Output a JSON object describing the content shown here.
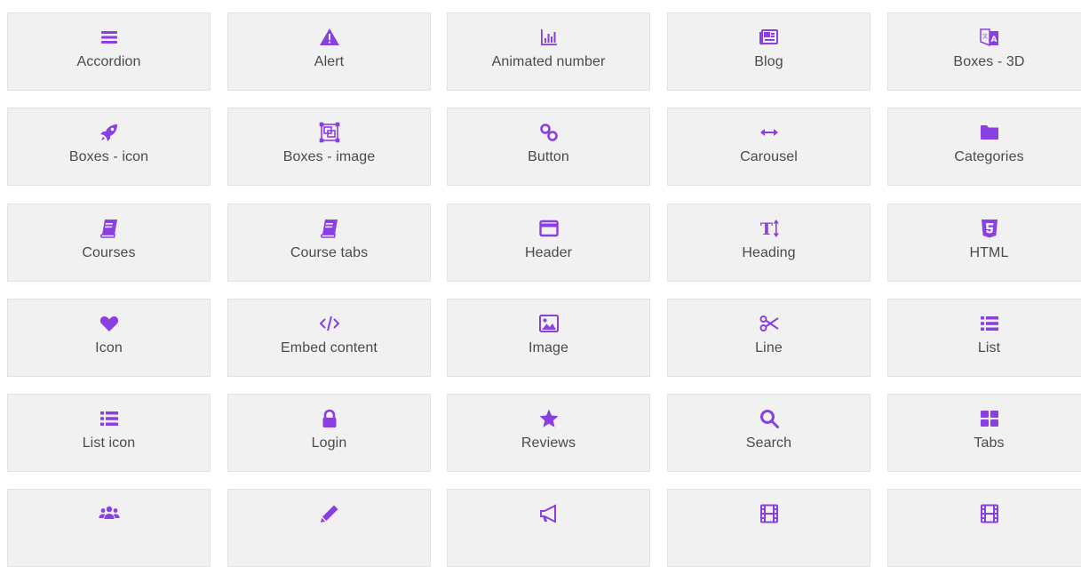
{
  "tiles": [
    {
      "label": "Accordion",
      "icon": "bars-icon",
      "name": "tile-accordion"
    },
    {
      "label": "Alert",
      "icon": "warning-triangle-icon",
      "name": "tile-alert"
    },
    {
      "label": "Animated number",
      "icon": "bar-chart-icon",
      "name": "tile-animated-number"
    },
    {
      "label": "Blog",
      "icon": "newspaper-icon",
      "name": "tile-blog"
    },
    {
      "label": "Boxes - 3D",
      "icon": "translate-icon",
      "name": "tile-boxes-3d"
    },
    {
      "label": "Boxes - icon",
      "icon": "rocket-icon",
      "name": "tile-boxes-icon"
    },
    {
      "label": "Boxes - image",
      "icon": "object-group-icon",
      "name": "tile-boxes-image"
    },
    {
      "label": "Button",
      "icon": "link-icon",
      "name": "tile-button"
    },
    {
      "label": "Carousel",
      "icon": "arrows-horizontal-icon",
      "name": "tile-carousel"
    },
    {
      "label": "Categories",
      "icon": "folder-icon",
      "name": "tile-categories"
    },
    {
      "label": "Courses",
      "icon": "book-icon",
      "name": "tile-courses"
    },
    {
      "label": "Course tabs",
      "icon": "book-icon",
      "name": "tile-course-tabs"
    },
    {
      "label": "Header",
      "icon": "window-icon",
      "name": "tile-header"
    },
    {
      "label": "Heading",
      "icon": "text-height-icon",
      "name": "tile-heading"
    },
    {
      "label": "HTML",
      "icon": "html5-icon",
      "name": "tile-html"
    },
    {
      "label": "Icon",
      "icon": "heart-icon",
      "name": "tile-icon"
    },
    {
      "label": "Embed content",
      "icon": "code-icon",
      "name": "tile-embed-content"
    },
    {
      "label": "Image",
      "icon": "image-icon",
      "name": "tile-image"
    },
    {
      "label": "Line",
      "icon": "scissors-icon",
      "name": "tile-line"
    },
    {
      "label": "List",
      "icon": "list-icon",
      "name": "tile-list"
    },
    {
      "label": "List icon",
      "icon": "list-icon",
      "name": "tile-list-icon"
    },
    {
      "label": "Login",
      "icon": "lock-icon",
      "name": "tile-login"
    },
    {
      "label": "Reviews",
      "icon": "star-icon",
      "name": "tile-reviews"
    },
    {
      "label": "Search",
      "icon": "search-icon",
      "name": "tile-search"
    },
    {
      "label": "Tabs",
      "icon": "grid-icon",
      "name": "tile-tabs"
    },
    {
      "label": "",
      "icon": "users-icon",
      "name": "tile-row6-1"
    },
    {
      "label": "",
      "icon": "pencil-icon",
      "name": "tile-row6-2"
    },
    {
      "label": "",
      "icon": "bullhorn-icon",
      "name": "tile-row6-3"
    },
    {
      "label": "",
      "icon": "film-icon",
      "name": "tile-row6-4"
    },
    {
      "label": "",
      "icon": "film-icon",
      "name": "tile-row6-5"
    }
  ],
  "colors": {
    "accent": "#8a3fe0",
    "tile_bg": "#f1f1f1",
    "tile_border": "#e2e2e2",
    "label": "#4a4a4a"
  }
}
